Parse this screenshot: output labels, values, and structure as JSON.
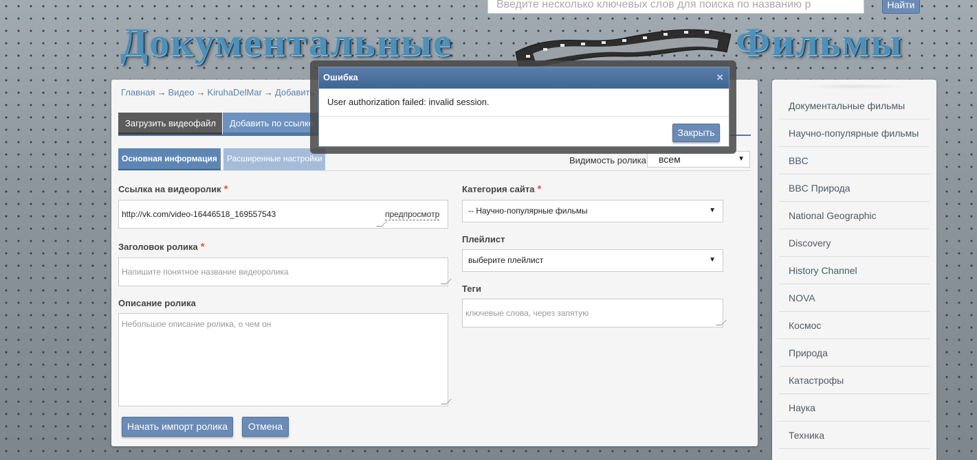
{
  "header": {
    "search_placeholder": "Введите несколько ключевых слов для поиска по названию р",
    "search_button": "Найти",
    "logo_left": "Документальные",
    "logo_right": "Фильмы"
  },
  "breadcrumb": {
    "items": [
      "Главная",
      "Видео",
      "KiruhaDelMar",
      "Добавить"
    ],
    "separator": "→"
  },
  "tabs": {
    "upload": "Загрузить видеофайл",
    "by_link": "Добавить по ссылке"
  },
  "subtabs": {
    "basic": "Основная информация",
    "advanced": "Расширенные настройки"
  },
  "visibility": {
    "label": "Видимость ролика",
    "value": "всем"
  },
  "form": {
    "video_link_label": "Ссылка на видеоролик",
    "video_link_value": "http://vk.com/video-16446518_169557543",
    "preview_link": "предпросмотр",
    "title_label": "Заголовок ролика",
    "title_placeholder": "Напишите понятное название видеоролика",
    "description_label": "Описание ролика",
    "description_placeholder": "Небольшое описание ролика, о чем он",
    "category_label": "Категория сайта",
    "category_value": "-- Научно-популярные фильмы",
    "playlist_label": "Плейлист",
    "playlist_value": "выберите плейлист",
    "tags_label": "Теги",
    "tags_placeholder": "ключевые слова, через запятую",
    "required_mark": "*",
    "submit_button": "Начать импорт ролика",
    "cancel_button": "Отмена"
  },
  "sidebar": {
    "items": [
      "Документальные фильмы",
      "Научно-популярные фильмы",
      "BBC",
      "BBC Природа",
      "National Geographic",
      "Discovery",
      "History Channel",
      "NOVA",
      "Космос",
      "Природа",
      "Катастрофы",
      "Наука",
      "Техника"
    ]
  },
  "modal": {
    "title": "Ошибка",
    "close_icon": "×",
    "message": "User authorization failed: invalid session.",
    "close_button": "Закрыть"
  },
  "icons": {
    "caret": "▼"
  },
  "colors": {
    "accent": "#6a8bb5",
    "modal_header": "#4a6f9e",
    "required": "#e8533a"
  }
}
